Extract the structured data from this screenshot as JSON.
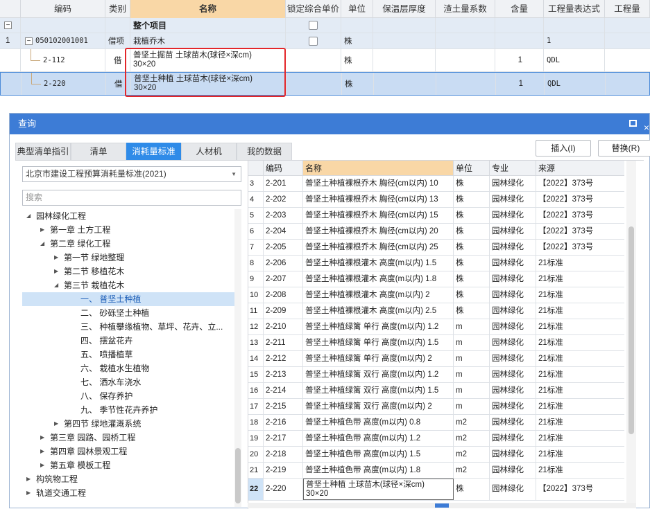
{
  "top_grid": {
    "headers": [
      "编码",
      "类别",
      "名称",
      "锁定综合单价",
      "单位",
      "保温层厚度",
      "渣土量系数",
      "含量",
      "工程量表达式",
      "工程量"
    ],
    "project_row": {
      "expander": "−",
      "name": "整个项目"
    },
    "rows": [
      {
        "index": "1",
        "code": "050102001001",
        "type": "借项",
        "name_line1": "栽植乔木",
        "name_line2": "",
        "unit": "株",
        "content": "",
        "expr": "1"
      },
      {
        "index": "",
        "code": "2-112",
        "type": "借",
        "name_line1": "普坚土掘苗 土球苗木(球径×深cm)",
        "name_line2": "30×20",
        "unit": "株",
        "content": "1",
        "expr": "QDL"
      },
      {
        "index": "",
        "code": "2-220",
        "type": "借",
        "name_line1": "普坚土种植 土球苗木(球径×深cm)",
        "name_line2": "30×20",
        "unit": "株",
        "content": "1",
        "expr": "QDL"
      }
    ]
  },
  "dialog": {
    "title": "查询",
    "tabs": [
      "典型清单指引",
      "清单",
      "消耗量标准",
      "人材机",
      "我的数据"
    ],
    "active_tab": "消耗量标准",
    "buttons": {
      "insert": "插入(I)",
      "replace": "替换(R)"
    },
    "standard_select": "北京市建设工程预算消耗量标准(2021)",
    "search_placeholder": "搜索",
    "tree": [
      {
        "label": "园林绿化工程",
        "level": 0,
        "toggle": "◢"
      },
      {
        "label": "第一章 土方工程",
        "level": 1,
        "toggle": "▶"
      },
      {
        "label": "第二章 绿化工程",
        "level": 1,
        "toggle": "◢"
      },
      {
        "label": "第一节 绿地整理",
        "level": 2,
        "toggle": "▶"
      },
      {
        "label": "第二节 移植花木",
        "level": 2,
        "toggle": "▶"
      },
      {
        "label": "第三节 栽植花木",
        "level": 2,
        "toggle": "◢"
      },
      {
        "label": "一、 普坚土种植",
        "level": 3,
        "toggle": "",
        "selected": true
      },
      {
        "label": "二、 砂砾坚土种植",
        "level": 3,
        "toggle": ""
      },
      {
        "label": "三、 种植攀缘植物、草坪、花卉、立...",
        "level": 3,
        "toggle": ""
      },
      {
        "label": "四、 摆盆花卉",
        "level": 3,
        "toggle": ""
      },
      {
        "label": "五、 喷播植草",
        "level": 3,
        "toggle": ""
      },
      {
        "label": "六、 栽植水生植物",
        "level": 3,
        "toggle": ""
      },
      {
        "label": "七、 洒水车浇水",
        "level": 3,
        "toggle": ""
      },
      {
        "label": "八、 保存养护",
        "level": 3,
        "toggle": ""
      },
      {
        "label": "九、 季节性花卉养护",
        "level": 3,
        "toggle": ""
      },
      {
        "label": "第四节 绿地灌溉系统",
        "level": 2,
        "toggle": "▶"
      },
      {
        "label": "第三章 园路、园桥工程",
        "level": 1,
        "toggle": "▶"
      },
      {
        "label": "第四章 园林景观工程",
        "level": 1,
        "toggle": "▶"
      },
      {
        "label": "第五章 模板工程",
        "level": 1,
        "toggle": "▶"
      },
      {
        "label": "构筑物工程",
        "level": 0,
        "toggle": "▶"
      },
      {
        "label": "轨道交通工程",
        "level": 0,
        "toggle": "▶"
      }
    ],
    "grid_headers": [
      "",
      "编码",
      "名称",
      "单位",
      "专业",
      "来源"
    ],
    "grid_rows": [
      {
        "i": "3",
        "code": "2-201",
        "name": "普坚土种植裸根乔木 胸径(cm以内) 10",
        "unit": "株",
        "major": "园林绿化",
        "src": "【2022】373号"
      },
      {
        "i": "4",
        "code": "2-202",
        "name": "普坚土种植裸根乔木 胸径(cm以内) 13",
        "unit": "株",
        "major": "园林绿化",
        "src": "【2022】373号"
      },
      {
        "i": "5",
        "code": "2-203",
        "name": "普坚土种植裸根乔木 胸径(cm以内) 15",
        "unit": "株",
        "major": "园林绿化",
        "src": "【2022】373号"
      },
      {
        "i": "6",
        "code": "2-204",
        "name": "普坚土种植裸根乔木 胸径(cm以内) 20",
        "unit": "株",
        "major": "园林绿化",
        "src": "【2022】373号"
      },
      {
        "i": "7",
        "code": "2-205",
        "name": "普坚土种植裸根乔木 胸径(cm以内) 25",
        "unit": "株",
        "major": "园林绿化",
        "src": "【2022】373号"
      },
      {
        "i": "8",
        "code": "2-206",
        "name": "普坚土种植裸根灌木 高度(m以内) 1.5",
        "unit": "株",
        "major": "园林绿化",
        "src": "21标准"
      },
      {
        "i": "9",
        "code": "2-207",
        "name": "普坚土种植裸根灌木 高度(m以内) 1.8",
        "unit": "株",
        "major": "园林绿化",
        "src": "21标准"
      },
      {
        "i": "10",
        "code": "2-208",
        "name": "普坚土种植裸根灌木 高度(m以内) 2",
        "unit": "株",
        "major": "园林绿化",
        "src": "21标准"
      },
      {
        "i": "11",
        "code": "2-209",
        "name": "普坚土种植裸根灌木 高度(m以内) 2.5",
        "unit": "株",
        "major": "园林绿化",
        "src": "21标准"
      },
      {
        "i": "12",
        "code": "2-210",
        "name": "普坚土种植绿篱 单行 高度(m以内) 1.2",
        "unit": "m",
        "major": "园林绿化",
        "src": "21标准"
      },
      {
        "i": "13",
        "code": "2-211",
        "name": "普坚土种植绿篱 单行 高度(m以内) 1.5",
        "unit": "m",
        "major": "园林绿化",
        "src": "21标准"
      },
      {
        "i": "14",
        "code": "2-212",
        "name": "普坚土种植绿篱 单行 高度(m以内) 2",
        "unit": "m",
        "major": "园林绿化",
        "src": "21标准"
      },
      {
        "i": "15",
        "code": "2-213",
        "name": "普坚土种植绿篱 双行 高度(m以内) 1.2",
        "unit": "m",
        "major": "园林绿化",
        "src": "21标准"
      },
      {
        "i": "16",
        "code": "2-214",
        "name": "普坚土种植绿篱 双行 高度(m以内) 1.5",
        "unit": "m",
        "major": "园林绿化",
        "src": "21标准"
      },
      {
        "i": "17",
        "code": "2-215",
        "name": "普坚土种植绿篱 双行 高度(m以内) 2",
        "unit": "m",
        "major": "园林绿化",
        "src": "21标准"
      },
      {
        "i": "18",
        "code": "2-216",
        "name": "普坚土种植色带 高度(m以内) 0.8",
        "unit": "m2",
        "major": "园林绿化",
        "src": "21标准"
      },
      {
        "i": "19",
        "code": "2-217",
        "name": "普坚土种植色带 高度(m以内) 1.2",
        "unit": "m2",
        "major": "园林绿化",
        "src": "21标准"
      },
      {
        "i": "20",
        "code": "2-218",
        "name": "普坚土种植色带 高度(m以内) 1.5",
        "unit": "m2",
        "major": "园林绿化",
        "src": "21标准"
      },
      {
        "i": "21",
        "code": "2-219",
        "name": "普坚土种植色带 高度(m以内) 1.8",
        "unit": "m2",
        "major": "园林绿化",
        "src": "21标准"
      },
      {
        "i": "22",
        "code": "2-220",
        "name": "普坚土种植 土球苗木(球径×深cm)",
        "name2": "30×20",
        "unit": "株",
        "major": "园林绿化",
        "src": "【2022】373号",
        "selected": true
      }
    ]
  }
}
